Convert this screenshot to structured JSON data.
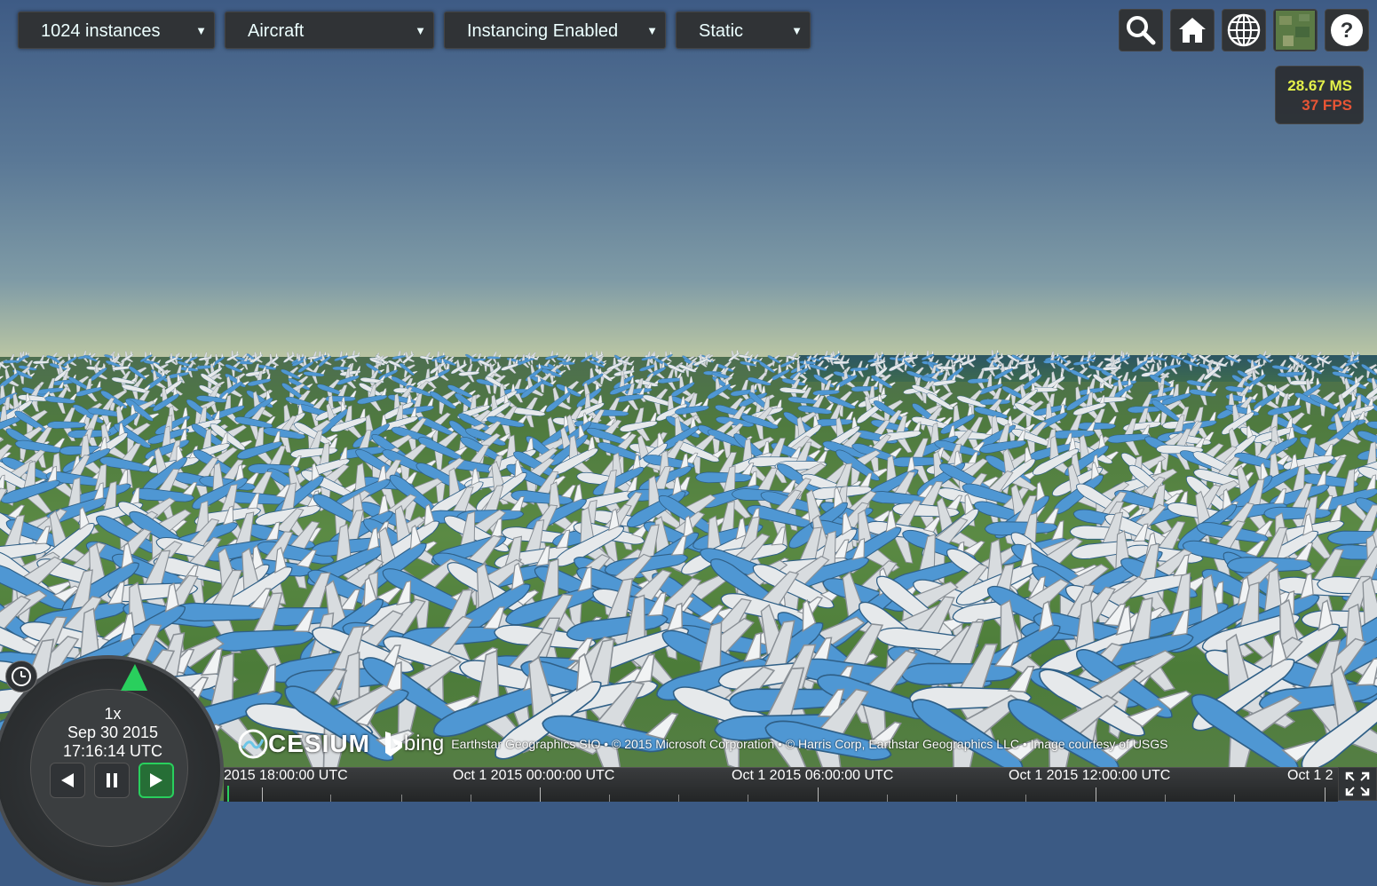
{
  "toolbar": {
    "dropdowns": [
      {
        "label": "1024 instances"
      },
      {
        "label": "Aircraft"
      },
      {
        "label": "Instancing Enabled"
      },
      {
        "label": "Static"
      }
    ],
    "buttons": [
      "search-icon",
      "home-icon",
      "globe-icon",
      "imagery-layer-icon",
      "help-icon"
    ]
  },
  "performance": {
    "ms": "28.67 MS",
    "fps": "37 FPS"
  },
  "clock": {
    "speed": "1x",
    "date": "Sep 30 2015",
    "time": "17:16:14 UTC"
  },
  "timeline": {
    "labels": [
      "2015 18:00:00 UTC",
      "Oct 1 2015 00:00:00 UTC",
      "Oct 1 2015 06:00:00 UTC",
      "Oct 1 2015 12:00:00 UTC",
      "Oct 1 2"
    ]
  },
  "credits": {
    "cesium": "CESIUM",
    "bing": "bing",
    "attribution": "Earthstar Geographics SIO • © 2015 Microsoft Corporation • © Harris Corp, Earthstar Geographics LLC • Image courtesy of USGS"
  },
  "colors": {
    "accent_green": "#29cf5d",
    "ms_color": "#e4f14a",
    "fps_color": "#e85535"
  }
}
